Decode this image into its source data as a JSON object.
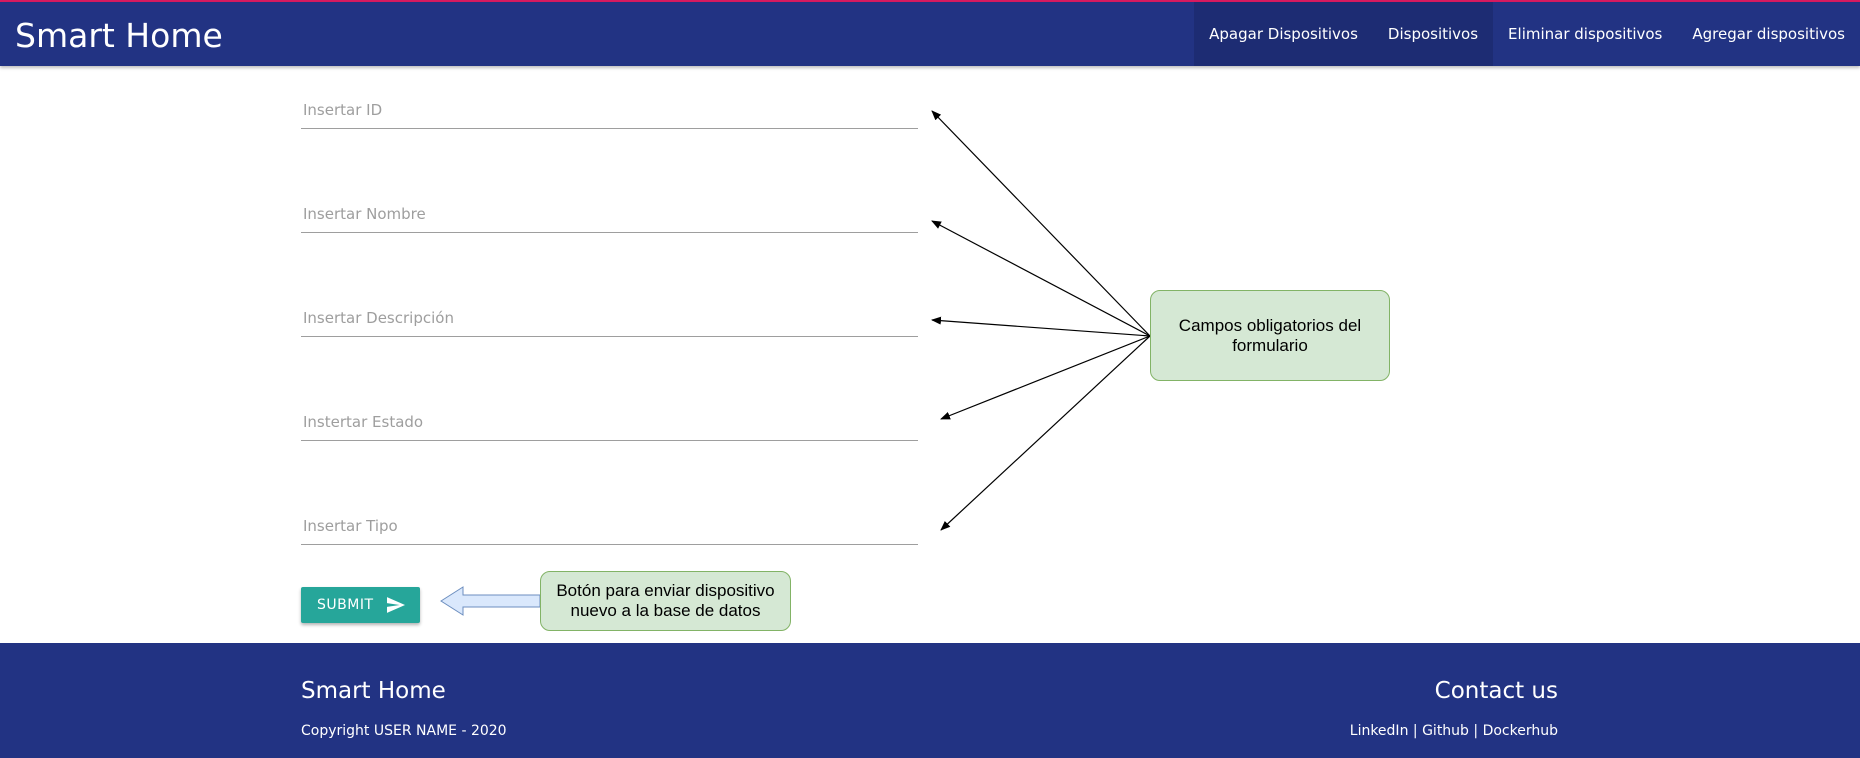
{
  "navbar": {
    "brand": "Smart Home",
    "items": [
      {
        "label": "Apagar Dispositivos"
      },
      {
        "label": "Dispositivos"
      },
      {
        "label": "Eliminar dispositivos"
      },
      {
        "label": "Agregar dispositivos"
      }
    ]
  },
  "form": {
    "fields": [
      {
        "placeholder": "Insertar ID"
      },
      {
        "placeholder": "Insertar Nombre"
      },
      {
        "placeholder": "Insertar Descripción"
      },
      {
        "placeholder": "Instertar Estado"
      },
      {
        "placeholder": "Insertar Tipo"
      }
    ],
    "submit_label": "SUBMIT",
    "submit_icon": "send-icon"
  },
  "annotations": {
    "fields_note": "Campos obligatorios del formulario",
    "submit_note": "Botón para enviar dispositivo nuevo a la base de datos"
  },
  "footer": {
    "title": "Smart Home",
    "copyright": "Copyright USER NAME - 2020",
    "contact_title": "Contact us",
    "links": [
      {
        "label": "LinkedIn"
      },
      {
        "label": "Github"
      },
      {
        "label": "Dockerhub"
      }
    ],
    "separator": " | "
  },
  "colors": {
    "navbar": "#223383",
    "accent_top": "#d81b60",
    "submit": "#26a69a",
    "callout_fill": "#d5e8d4",
    "callout_border": "#82b366",
    "arrow_fill": "#dae8fc",
    "arrow_border": "#6c8ebf"
  }
}
